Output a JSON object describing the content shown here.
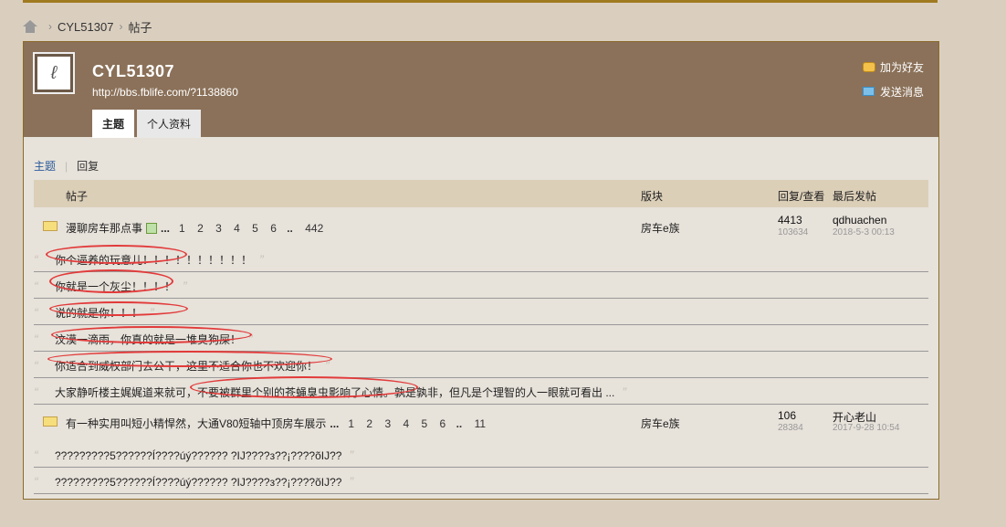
{
  "breadcrumb": {
    "user": "CYL51307",
    "section": "帖子"
  },
  "profile": {
    "username": "CYL51307",
    "url": "http://bbs.fblife.com/?1138860",
    "tabs": [
      "主题",
      "个人资料"
    ],
    "actions": {
      "add_friend": "加为好友",
      "send_message": "发送消息"
    }
  },
  "subtabs": {
    "active": "主题",
    "inactive": "回复"
  },
  "table": {
    "headers": {
      "post": "帖子",
      "board": "版块",
      "stats": "回复/查看",
      "last": "最后发帖"
    }
  },
  "threads": [
    {
      "title": "漫聊房车那点事",
      "pages": [
        "1",
        "2",
        "3",
        "4",
        "5",
        "6",
        "..",
        "442"
      ],
      "board": "房车e族",
      "replies": "4413",
      "views": "103634",
      "last_user": "qdhuachen",
      "last_time": "2018-5-3 00:13",
      "quotes": [
        "你个逼养的玩意儿！！！！！！！！！！",
        "你就是一个灰尘！！！！",
        "说的就是你！！！",
        "汶漠一滴雨，你真的就是一堆臭狗屎！",
        "你适合到威权部门去公干，这里不适合你也不欢迎你！",
        "大家静听楼主娓娓道来就可，不要被群里个别的苍蝇臭虫影响了心情。孰是孰非，但凡是个理智的人一眼就可看出 ..."
      ]
    },
    {
      "title": "有一种实用叫短小精悍然，大通V80短轴中顶房车展示",
      "pages": [
        "1",
        "2",
        "3",
        "4",
        "5",
        "6",
        "..",
        "11"
      ],
      "board": "房车e族",
      "replies": "106",
      "views": "28384",
      "last_user": "开心老山",
      "last_time": "2017-9-28 10:54",
      "quotes": [
        "?????????5??????Í????úý??????   ?IJ????з??¡????õIJ??",
        "?????????5??????Í????úý??????   ?IJ????з??¡????õIJ??"
      ]
    }
  ],
  "colors": {
    "header_bg": "#8b7159",
    "page_bg": "#dacfbf",
    "panel_bg": "#e7e2da",
    "annotation": "#e23a3a"
  }
}
